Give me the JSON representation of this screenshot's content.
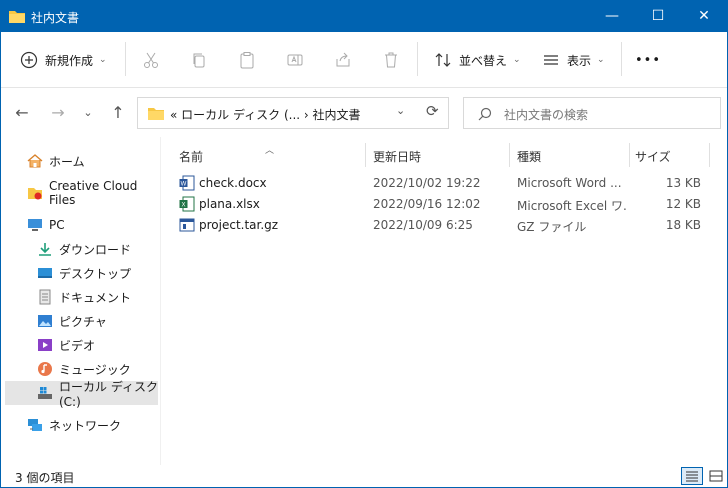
{
  "window": {
    "title": "社内文書",
    "minimize_glyph": "—",
    "maximize_glyph": "☐",
    "close_glyph": "✕"
  },
  "toolbar": {
    "new_label": "新規作成",
    "sort_label": "並べ替え",
    "view_label": "表示",
    "more_label": "•••",
    "icons": [
      "plus-circle-icon",
      "cut-icon",
      "copy-icon",
      "paste-icon",
      "rename-icon",
      "share-icon",
      "delete-icon",
      "sort-icon",
      "view-icon",
      "more-icon"
    ]
  },
  "address": {
    "path_text": "«  ローカル ディスク (...  ›  社内文書",
    "search_placeholder": "社内文書の検索"
  },
  "sidebar": {
    "items": [
      {
        "label": "ホーム",
        "icon": "home-icon"
      },
      {
        "label": "Creative Cloud Files",
        "icon": "creative-cloud-icon"
      },
      {
        "label": "PC",
        "icon": "pc-icon"
      },
      {
        "label": "ダウンロード",
        "icon": "download-icon"
      },
      {
        "label": "デスクトップ",
        "icon": "desktop-icon"
      },
      {
        "label": "ドキュメント",
        "icon": "documents-icon"
      },
      {
        "label": "ピクチャ",
        "icon": "pictures-icon"
      },
      {
        "label": "ビデオ",
        "icon": "videos-icon"
      },
      {
        "label": "ミュージック",
        "icon": "music-icon"
      },
      {
        "label": "ローカル ディスク (C:)",
        "icon": "drive-icon",
        "selected": true
      },
      {
        "label": "ネットワーク",
        "icon": "network-icon"
      }
    ]
  },
  "list": {
    "columns": {
      "name": "名前",
      "date": "更新日時",
      "type": "種類",
      "size": "サイズ"
    },
    "rows": [
      {
        "name": "check.docx",
        "date": "2022/10/02 19:22",
        "type": "Microsoft Word ...",
        "size": "13 KB",
        "icon": "word-file-icon"
      },
      {
        "name": "plana.xlsx",
        "date": "2022/09/16 12:02",
        "type": "Microsoft Excel ワ...",
        "size": "12 KB",
        "icon": "excel-file-icon"
      },
      {
        "name": "project.tar.gz",
        "date": "2022/10/09 6:25",
        "type": "GZ ファイル",
        "size": "18 KB",
        "icon": "archive-file-icon"
      }
    ]
  },
  "status": {
    "item_count": "3 個の項目"
  },
  "colors": {
    "titlebar": "#0063b1",
    "folder": "#f7c744",
    "selection": "#e5e5e5"
  }
}
